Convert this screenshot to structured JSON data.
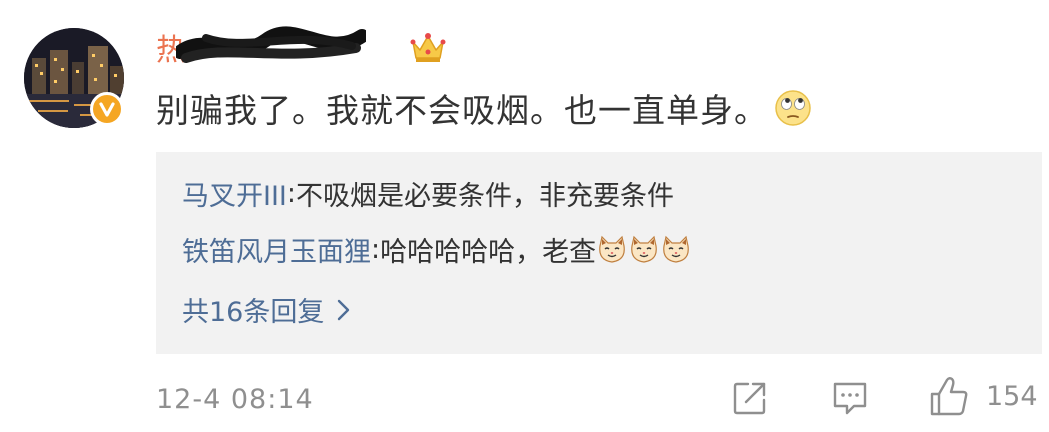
{
  "comment": {
    "username": "热",
    "text": "别骗我了。我就不会吸烟。也一直单身。",
    "timestamp": "12-4 08:14",
    "like_count": "154",
    "icons": {
      "avatar": "avatar-city-night",
      "verified": "verified-badge-icon",
      "crown": "crown-icon",
      "emoji": "eye-roll-emoji-icon",
      "share": "share-icon",
      "comment": "comment-icon",
      "like": "thumbs-up-icon"
    }
  },
  "replies": [
    {
      "author": "马叉开III",
      "colon": ": ",
      "content": "不吸烟是必要条件，非充要条件"
    },
    {
      "author": "铁笛风月玉面狸",
      "colon": ": ",
      "content": "哈哈哈哈哈，老查"
    }
  ],
  "more_replies_label": "共16条回复",
  "colors": {
    "username": "#eb7350",
    "link": "#4e6d96",
    "text": "#333333",
    "muted": "#8f8f8f",
    "reply_bg": "#f2f2f2",
    "badge": "#f5a623"
  }
}
